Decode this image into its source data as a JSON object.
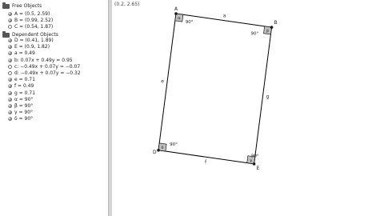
{
  "algebra": {
    "free_header": "Free Objects",
    "free": [
      {
        "text": "A = (0.5, 2.59)",
        "shown": true
      },
      {
        "text": "B = (0.99, 2.52)",
        "shown": true
      },
      {
        "text": "C = (0.54, 1.87)",
        "shown": false
      }
    ],
    "dependent_header": "Dependent Objects",
    "dependent": [
      {
        "text": "D = (0.41, 1.89)",
        "shown": true
      },
      {
        "text": "E = (0.9, 1.82)",
        "shown": true
      },
      {
        "text": "a = 0.49",
        "shown": true
      },
      {
        "text": "b: 0.07x + 0.49y = 0.95",
        "shown": true
      },
      {
        "text": "c: −0.49x + 0.07y = −0.07",
        "shown": false
      },
      {
        "text": "d: −0.49x + 0.07y = −0.32",
        "shown": false
      },
      {
        "text": "e = 0.71",
        "shown": true
      },
      {
        "text": "f = 0.49",
        "shown": true
      },
      {
        "text": "g = 0.71",
        "shown": true
      },
      {
        "text": "α = 90°",
        "shown": true
      },
      {
        "text": "β = 90°",
        "shown": true
      },
      {
        "text": "γ = 90°",
        "shown": true
      },
      {
        "text": "δ = 90°",
        "shown": true
      }
    ]
  },
  "graphics": {
    "coord_readout": "(0.2, 2.65)",
    "points": [
      {
        "label": "A",
        "x": 0.5,
        "y": 2.59
      },
      {
        "label": "B",
        "x": 0.99,
        "y": 2.52
      },
      {
        "label": "E",
        "x": 0.9,
        "y": 1.82
      },
      {
        "label": "D",
        "x": 0.41,
        "y": 1.89
      }
    ],
    "segment_labels": [
      "a",
      "g",
      "f",
      "e"
    ],
    "angles": [
      {
        "vertex": "A",
        "letter": "α",
        "value": "90°"
      },
      {
        "vertex": "B",
        "letter": "β",
        "value": "90°"
      },
      {
        "vertex": "E",
        "letter": "γ",
        "value": "90°"
      },
      {
        "vertex": "D",
        "letter": "δ",
        "value": "90°"
      }
    ],
    "colors": {
      "line": "#000000",
      "point": "#1a1a1a",
      "angle_fill": "#bfbfbf"
    }
  }
}
